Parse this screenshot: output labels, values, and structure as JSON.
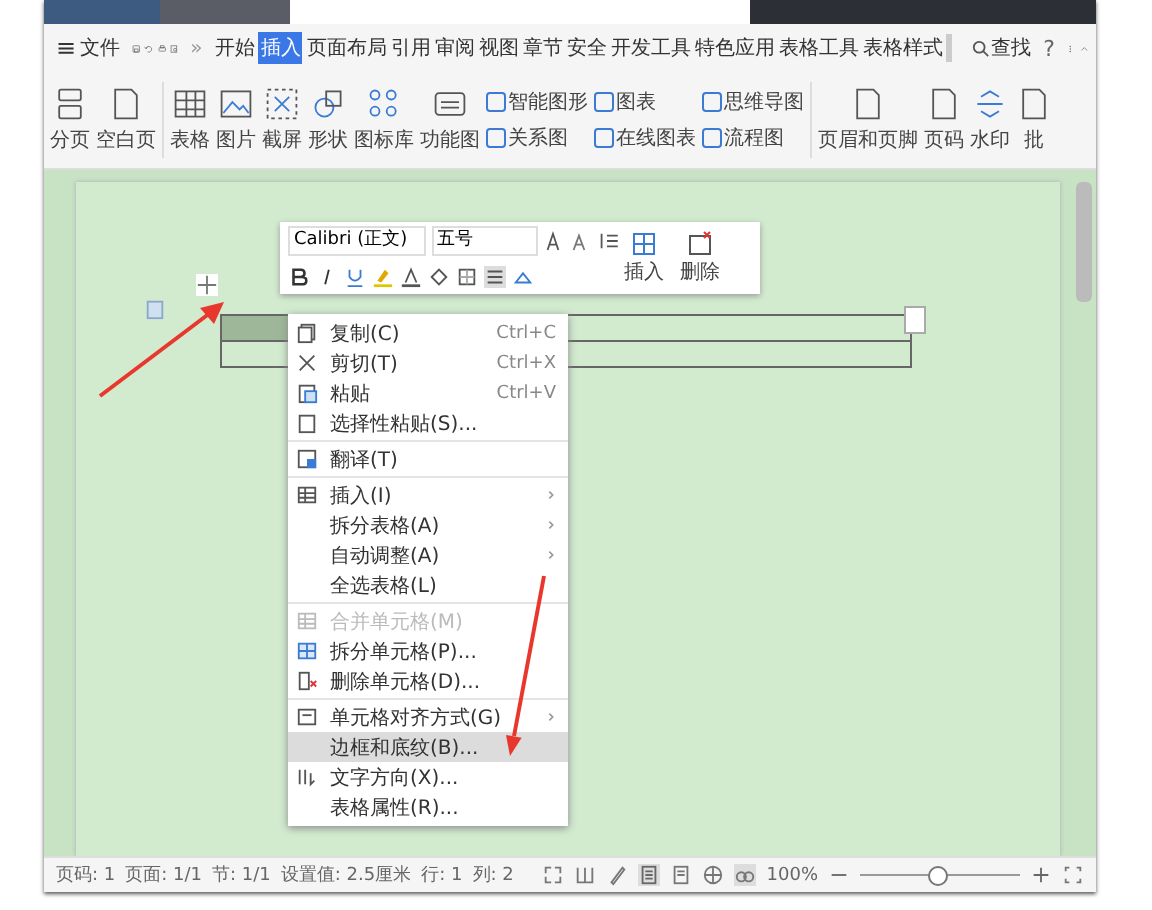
{
  "menu_bar": {
    "menu_icon": "≡",
    "file_label": "文件",
    "more": "»",
    "tabs": [
      {
        "label": "开始",
        "selected": false
      },
      {
        "label": "插入",
        "selected": true
      },
      {
        "label": "页面布局",
        "selected": false
      },
      {
        "label": "引用",
        "selected": false
      },
      {
        "label": "审阅",
        "selected": false
      },
      {
        "label": "视图",
        "selected": false
      },
      {
        "label": "章节",
        "selected": false
      },
      {
        "label": "安全",
        "selected": false
      },
      {
        "label": "开发工具",
        "selected": false
      },
      {
        "label": "特色应用",
        "selected": false
      },
      {
        "label": "表格工具",
        "selected": false
      },
      {
        "label": "表格样式",
        "selected": false
      }
    ],
    "search": "查找",
    "help": "?"
  },
  "ribbon": [
    {
      "kind": "large",
      "label": "分页"
    },
    {
      "kind": "large",
      "label": "空白页"
    },
    {
      "kind": "gap"
    },
    {
      "kind": "large",
      "label": "表格"
    },
    {
      "kind": "large",
      "label": "图片"
    },
    {
      "kind": "large",
      "label": "截屏"
    },
    {
      "kind": "large",
      "label": "形状"
    },
    {
      "kind": "large",
      "label": "图标库"
    },
    {
      "kind": "large",
      "label": "功能图"
    },
    {
      "kind": "pair",
      "top": "智能图形",
      "bottom": "关系图"
    },
    {
      "kind": "pair",
      "top": "图表",
      "bottom": "在线图表"
    },
    {
      "kind": "pair",
      "top": "思维导图",
      "bottom": "流程图"
    },
    {
      "kind": "gap"
    },
    {
      "kind": "large",
      "label": "页眉和页脚"
    },
    {
      "kind": "large",
      "label": "页码"
    },
    {
      "kind": "large",
      "label": "水印"
    },
    {
      "kind": "large",
      "label": "批"
    }
  ],
  "mini_toolbar": {
    "font": "Calibri (正文)",
    "size": "五号",
    "insert": "插入",
    "delete": "删除"
  },
  "context_menu": [
    {
      "kind": "item",
      "label": "复制(C)",
      "shortcut": "Ctrl+C",
      "submenu": false,
      "disabled": false,
      "selected": false
    },
    {
      "kind": "item",
      "label": "剪切(T)",
      "shortcut": "Ctrl+X",
      "submenu": false,
      "disabled": false,
      "selected": false
    },
    {
      "kind": "item",
      "label": "粘贴",
      "shortcut": "Ctrl+V",
      "submenu": false,
      "disabled": false,
      "selected": false
    },
    {
      "kind": "item",
      "label": "选择性粘贴(S)...",
      "submenu": false,
      "disabled": false,
      "selected": false
    },
    {
      "kind": "separator"
    },
    {
      "kind": "item",
      "label": "翻译(T)",
      "submenu": false,
      "disabled": false,
      "selected": false
    },
    {
      "kind": "separator"
    },
    {
      "kind": "item",
      "label": "插入(I)",
      "submenu": true,
      "disabled": false,
      "selected": false
    },
    {
      "kind": "item",
      "label": "拆分表格(A)",
      "submenu": true,
      "disabled": false,
      "selected": false
    },
    {
      "kind": "item",
      "label": "自动调整(A)",
      "submenu": true,
      "disabled": false,
      "selected": false
    },
    {
      "kind": "item",
      "label": "全选表格(L)",
      "submenu": false,
      "disabled": false,
      "selected": false
    },
    {
      "kind": "separator"
    },
    {
      "kind": "item",
      "label": "合并单元格(M)",
      "submenu": false,
      "disabled": true,
      "selected": false
    },
    {
      "kind": "item",
      "label": "拆分单元格(P)...",
      "submenu": false,
      "disabled": false,
      "selected": false
    },
    {
      "kind": "item",
      "label": "删除单元格(D)...",
      "submenu": false,
      "disabled": false,
      "selected": false
    },
    {
      "kind": "separator"
    },
    {
      "kind": "item",
      "label": "单元格对齐方式(G)",
      "submenu": true,
      "disabled": false,
      "selected": false
    },
    {
      "kind": "item",
      "label": "边框和底纹(B)...",
      "submenu": false,
      "disabled": false,
      "selected": true
    },
    {
      "kind": "item",
      "label": "文字方向(X)...",
      "submenu": false,
      "disabled": false,
      "selected": false
    },
    {
      "kind": "item",
      "label": "表格属性(R)...",
      "submenu": false,
      "disabled": false,
      "selected": false
    }
  ],
  "status_bar": {
    "items": [
      "页码: 1",
      "页面: 1/1",
      "节: 1/1",
      "设置值: 2.5厘米",
      "行: 1",
      "列: 2"
    ],
    "zoom": "100%",
    "zoom_slider": {
      "level": 0.48
    }
  }
}
